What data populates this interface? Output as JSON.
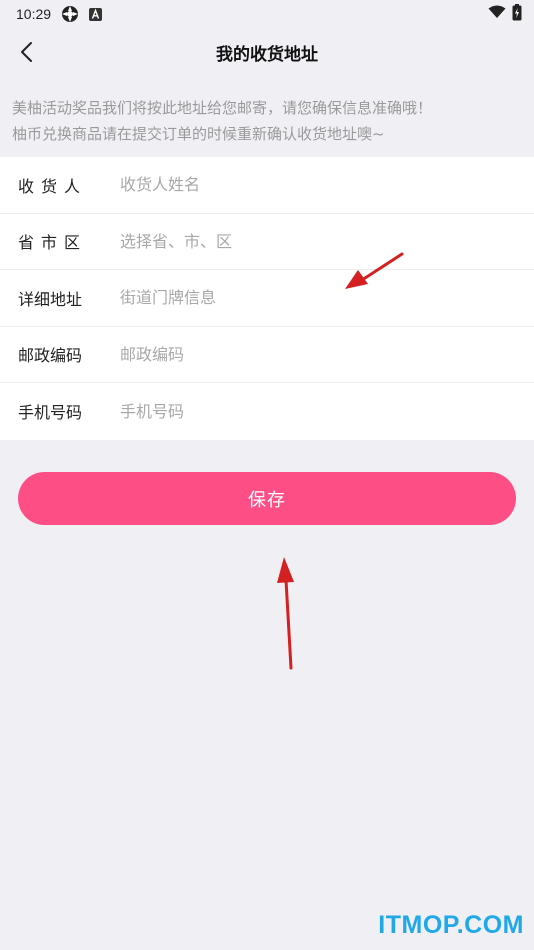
{
  "status_bar": {
    "time": "10:29"
  },
  "header": {
    "title": "我的收货地址"
  },
  "notice": {
    "line1": "美柚活动奖品我们将按此地址给您邮寄，请您确保信息准确哦！",
    "line2": "柚币兑换商品请在提交订单的时候重新确认收货地址噢~"
  },
  "form": {
    "rows": [
      {
        "label": "收货人",
        "placeholder": "收货人姓名",
        "value": ""
      },
      {
        "label": "省市区",
        "placeholder": "选择省、市、区",
        "value": ""
      },
      {
        "label": "详细地址",
        "placeholder": "街道门牌信息",
        "value": ""
      },
      {
        "label": "邮政编码",
        "placeholder": "邮政编码",
        "value": ""
      },
      {
        "label": "手机号码",
        "placeholder": "手机号码",
        "value": ""
      }
    ]
  },
  "actions": {
    "save_label": "保存"
  },
  "watermark": "ITMOP.COM",
  "colors": {
    "accent": "#fd4f86",
    "background": "#f0eff4",
    "annotation_arrow": "#d42020",
    "watermark": "#21a8e6"
  }
}
